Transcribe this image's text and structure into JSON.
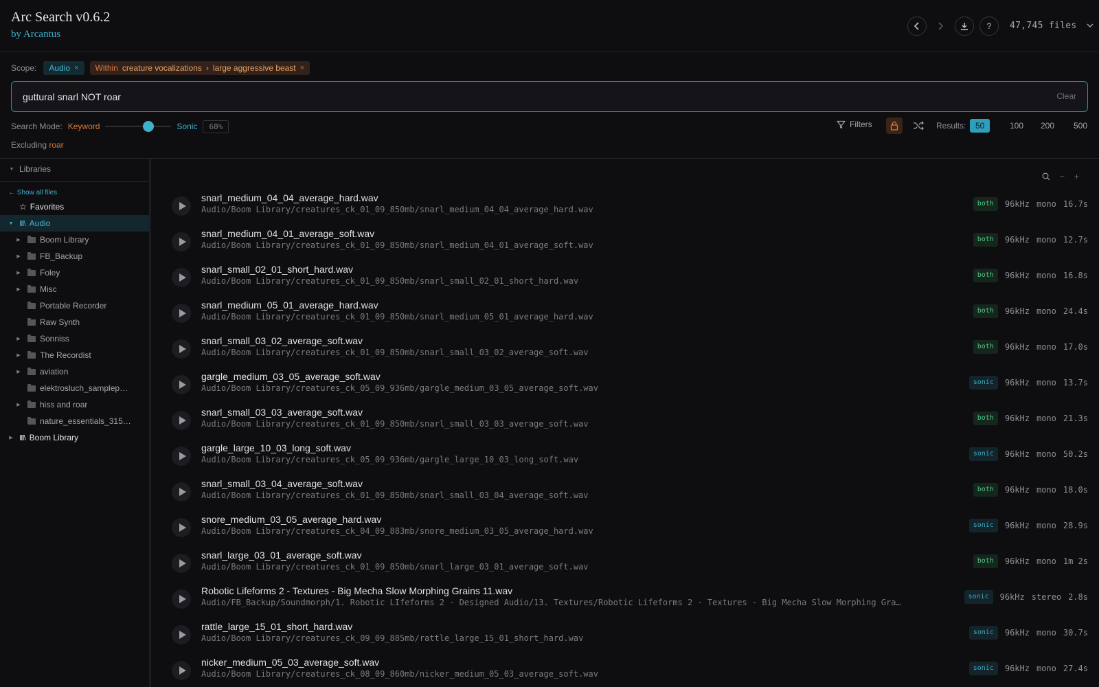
{
  "app": {
    "title": "Arc Search v0.6.2",
    "subtitle": "by Arcantus"
  },
  "header": {
    "file_count": "47,745 files"
  },
  "scope": {
    "label": "Scope:",
    "audio_chip": "Audio",
    "within_prefix": "Within",
    "within_path_1": "creature vocalizations",
    "within_sep": "›",
    "within_path_2": "large aggressive beast",
    "close": "×"
  },
  "search": {
    "value": "guttural snarl NOT roar",
    "clear": "Clear"
  },
  "mode": {
    "label": "Search Mode:",
    "keyword": "Keyword",
    "sonic": "Sonic",
    "percent": "68%",
    "level": 0.68
  },
  "excluding": {
    "prefix": "Excluding",
    "word": "roar"
  },
  "controls": {
    "filters": "Filters",
    "results_label": "Results:",
    "results_options": [
      "50",
      "100",
      "200",
      "500"
    ],
    "results_selected": "50"
  },
  "sidebar": {
    "header": "Libraries",
    "show_all": "← Show all files",
    "favorites": "Favorites",
    "audio_root": "Audio",
    "folders": [
      "Boom Library",
      "FB_Backup",
      "Foley",
      "Misc",
      "Portable Recorder",
      "Raw Synth",
      "Sonniss",
      "The Recordist",
      "aviation",
      "elektrosluch_samplep…",
      "hiss and roar",
      "nature_essentials_315…"
    ],
    "boom_root": "Boom Library"
  },
  "results": [
    {
      "name": "snarl_medium_04_04_average_hard.wav",
      "path": "Audio/Boom Library/creatures_ck_01_09_850mb/snarl_medium_04_04_average_hard.wav",
      "match": "both",
      "rate": "96kHz",
      "channels": "mono",
      "duration": "16.7s"
    },
    {
      "name": "snarl_medium_04_01_average_soft.wav",
      "path": "Audio/Boom Library/creatures_ck_01_09_850mb/snarl_medium_04_01_average_soft.wav",
      "match": "both",
      "rate": "96kHz",
      "channels": "mono",
      "duration": "12.7s"
    },
    {
      "name": "snarl_small_02_01_short_hard.wav",
      "path": "Audio/Boom Library/creatures_ck_01_09_850mb/snarl_small_02_01_short_hard.wav",
      "match": "both",
      "rate": "96kHz",
      "channels": "mono",
      "duration": "16.8s"
    },
    {
      "name": "snarl_medium_05_01_average_hard.wav",
      "path": "Audio/Boom Library/creatures_ck_01_09_850mb/snarl_medium_05_01_average_hard.wav",
      "match": "both",
      "rate": "96kHz",
      "channels": "mono",
      "duration": "24.4s"
    },
    {
      "name": "snarl_small_03_02_average_soft.wav",
      "path": "Audio/Boom Library/creatures_ck_01_09_850mb/snarl_small_03_02_average_soft.wav",
      "match": "both",
      "rate": "96kHz",
      "channels": "mono",
      "duration": "17.0s"
    },
    {
      "name": "gargle_medium_03_05_average_soft.wav",
      "path": "Audio/Boom Library/creatures_ck_05_09_936mb/gargle_medium_03_05_average_soft.wav",
      "match": "sonic",
      "rate": "96kHz",
      "channels": "mono",
      "duration": "13.7s"
    },
    {
      "name": "snarl_small_03_03_average_soft.wav",
      "path": "Audio/Boom Library/creatures_ck_01_09_850mb/snarl_small_03_03_average_soft.wav",
      "match": "both",
      "rate": "96kHz",
      "channels": "mono",
      "duration": "21.3s"
    },
    {
      "name": "gargle_large_10_03_long_soft.wav",
      "path": "Audio/Boom Library/creatures_ck_05_09_936mb/gargle_large_10_03_long_soft.wav",
      "match": "sonic",
      "rate": "96kHz",
      "channels": "mono",
      "duration": "50.2s"
    },
    {
      "name": "snarl_small_03_04_average_soft.wav",
      "path": "Audio/Boom Library/creatures_ck_01_09_850mb/snarl_small_03_04_average_soft.wav",
      "match": "both",
      "rate": "96kHz",
      "channels": "mono",
      "duration": "18.0s"
    },
    {
      "name": "snore_medium_03_05_average_hard.wav",
      "path": "Audio/Boom Library/creatures_ck_04_09_883mb/snore_medium_03_05_average_hard.wav",
      "match": "sonic",
      "rate": "96kHz",
      "channels": "mono",
      "duration": "28.9s"
    },
    {
      "name": "snarl_large_03_01_average_soft.wav",
      "path": "Audio/Boom Library/creatures_ck_01_09_850mb/snarl_large_03_01_average_soft.wav",
      "match": "both",
      "rate": "96kHz",
      "channels": "mono",
      "duration": "1m 2s"
    },
    {
      "name": "Robotic Lifeforms 2 - Textures - Big Mecha Slow Morphing Grains 11.wav",
      "path": "Audio/FB_Backup/Soundmorph/1. Robotic LIfeforms 2 - Designed Audio/13. Textures/Robotic Lifeforms 2 - Textures - Big Mecha Slow Morphing Grai…",
      "match": "sonic",
      "rate": "96kHz",
      "channels": "stereo",
      "duration": "2.8s"
    },
    {
      "name": "rattle_large_15_01_short_hard.wav",
      "path": "Audio/Boom Library/creatures_ck_09_09_885mb/rattle_large_15_01_short_hard.wav",
      "match": "sonic",
      "rate": "96kHz",
      "channels": "mono",
      "duration": "30.7s"
    },
    {
      "name": "nicker_medium_05_03_average_soft.wav",
      "path": "Audio/Boom Library/creatures_ck_08_09_860mb/nicker_medium_05_03_average_soft.wav",
      "match": "sonic",
      "rate": "96kHz",
      "channels": "mono",
      "duration": "27.4s"
    }
  ],
  "colors": {
    "accent": "#3fb0cc",
    "keyword": "#d97a3e",
    "both": "#52c48a",
    "sonic": "#3fa7c2",
    "background": "#0e0e11"
  }
}
